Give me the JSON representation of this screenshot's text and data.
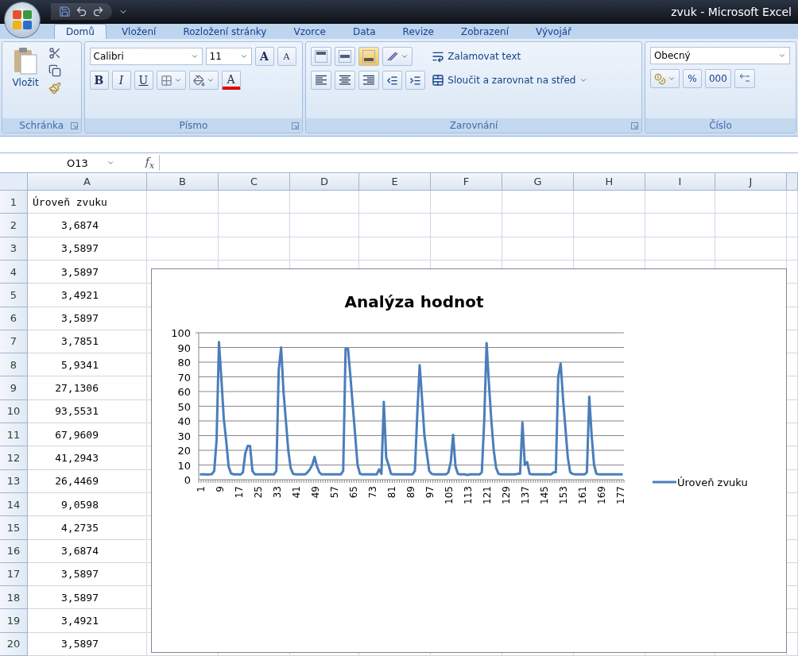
{
  "window": {
    "title": "zvuk - Microsoft Excel"
  },
  "tabs": [
    {
      "label": "Domů",
      "selected": true
    },
    {
      "label": "Vložení",
      "selected": false
    },
    {
      "label": "Rozložení stránky",
      "selected": false
    },
    {
      "label": "Vzorce",
      "selected": false
    },
    {
      "label": "Data",
      "selected": false
    },
    {
      "label": "Revize",
      "selected": false
    },
    {
      "label": "Zobrazení",
      "selected": false
    },
    {
      "label": "Vývojář",
      "selected": false
    }
  ],
  "ribbon": {
    "clipboard": {
      "paste": "Vložit",
      "label": "Schránka"
    },
    "font": {
      "font_name": "Calibri",
      "font_size": "11",
      "grow": "A",
      "shrink": "A",
      "bold": "B",
      "italic": "I",
      "underline": "U",
      "font_color": "A",
      "label": "Písmo"
    },
    "alignment": {
      "vertical": [
        {
          "kind": "top",
          "selected": false
        },
        {
          "kind": "middle",
          "selected": false
        },
        {
          "kind": "bottom",
          "selected": true
        }
      ],
      "wrap_text": "Zalamovat text",
      "merge": "Sloučit a zarovnat na střed",
      "label": "Zarovnání"
    },
    "number": {
      "format": "Obecný",
      "percent": "%",
      "thousands": "000",
      "label": "Číslo"
    }
  },
  "formula_bar": {
    "name_box": "O13",
    "function_label": "f$_{x}$"
  },
  "sheet": {
    "columns": [
      "A",
      "B",
      "C",
      "D",
      "E",
      "F",
      "G",
      "H",
      "I",
      "J"
    ],
    "rows": [
      {
        "number": "1",
        "a": "Úroveň zvuku"
      },
      {
        "number": "2",
        "a": "3,6874"
      },
      {
        "number": "3",
        "a": "3,5897"
      },
      {
        "number": "4",
        "a": "3,5897"
      },
      {
        "number": "5",
        "a": "3,4921"
      },
      {
        "number": "6",
        "a": "3,5897"
      },
      {
        "number": "7",
        "a": "3,7851"
      },
      {
        "number": "8",
        "a": "5,9341"
      },
      {
        "number": "9",
        "a": "27,1306"
      },
      {
        "number": "10",
        "a": "93,5531"
      },
      {
        "number": "11",
        "a": "67,9609"
      },
      {
        "number": "12",
        "a": "41,2943"
      },
      {
        "number": "13",
        "a": "26,4469"
      },
      {
        "number": "14",
        "a": "9,0598"
      },
      {
        "number": "15",
        "a": "4,2735"
      },
      {
        "number": "16",
        "a": "3,6874"
      },
      {
        "number": "17",
        "a": "3,5897"
      },
      {
        "number": "18",
        "a": "3,5897"
      },
      {
        "number": "19",
        "a": "3,4921"
      },
      {
        "number": "20",
        "a": "3,5897"
      }
    ],
    "chart": {
      "chart_data": {
        "type": "line",
        "title": "Analýza hodnot",
        "x": [
          1,
          2,
          3,
          4,
          5,
          6,
          7,
          8,
          9,
          10,
          11,
          12,
          13,
          14,
          15,
          16,
          17,
          18,
          19,
          20,
          21,
          22,
          23,
          24,
          25,
          26,
          27,
          28,
          29,
          30,
          31,
          32,
          33,
          34,
          35,
          36,
          37,
          38,
          39,
          40,
          41,
          42,
          43,
          44,
          45,
          46,
          47,
          48,
          49,
          50,
          51,
          52,
          53,
          54,
          55,
          56,
          57,
          58,
          59,
          60,
          61,
          62,
          63,
          64,
          65,
          66,
          67,
          68,
          69,
          70,
          71,
          72,
          73,
          74,
          75,
          76,
          77,
          78,
          79,
          80,
          81,
          82,
          83,
          84,
          85,
          86,
          87,
          88,
          89,
          90,
          91,
          92,
          93,
          94,
          95,
          96,
          97,
          98,
          99,
          100,
          101,
          102,
          103,
          104,
          105,
          106,
          107,
          108,
          109,
          110,
          111,
          112,
          113,
          114,
          115,
          116,
          117,
          118,
          119,
          120,
          121,
          122,
          123,
          124,
          125,
          126,
          127,
          128,
          129,
          130,
          131,
          132,
          133,
          134,
          135,
          136,
          137,
          138,
          139,
          140,
          141,
          142,
          143,
          144,
          145,
          146,
          147,
          148,
          149,
          150,
          151,
          152,
          153,
          154,
          155,
          156,
          157,
          158,
          159,
          160,
          161,
          162,
          163,
          164,
          165,
          166,
          167,
          168,
          169,
          170,
          171,
          172,
          173,
          174,
          175,
          176,
          177,
          178
        ],
        "xlim": [
          1,
          178
        ],
        "ylim": [
          0,
          100
        ],
        "grid": true,
        "xticks": [
          1,
          9,
          17,
          25,
          33,
          41,
          49,
          57,
          65,
          73,
          81,
          89,
          97,
          105,
          113,
          121,
          129,
          137,
          145,
          153,
          161,
          169,
          177
        ],
        "yticks": [
          0,
          10,
          20,
          30,
          40,
          50,
          60,
          70,
          80,
          90,
          100
        ],
        "series": [
          {
            "name": "Úroveň zvuku",
            "color": "#4a7ebb",
            "values": [
              3.7,
              3.6,
              3.6,
              3.5,
              3.6,
              3.8,
              5.9,
              27.1,
              93.6,
              68.0,
              41.3,
              26.4,
              9.1,
              4.3,
              3.7,
              3.6,
              3.6,
              3.5,
              5.0,
              18.0,
              23.0,
              23.0,
              6.0,
              3.7,
              3.6,
              3.6,
              3.6,
              3.6,
              3.6,
              3.6,
              3.6,
              3.6,
              6.0,
              75.0,
              90.0,
              60.0,
              40.0,
              20.0,
              8.0,
              4.0,
              3.6,
              3.6,
              3.6,
              3.6,
              3.6,
              5.0,
              7.0,
              10.0,
              15.5,
              9.0,
              5.0,
              3.6,
              3.6,
              3.6,
              3.6,
              3.6,
              3.6,
              3.6,
              3.6,
              3.6,
              6.0,
              89.0,
              89.0,
              70.0,
              50.0,
              30.0,
              10.0,
              4.0,
              3.6,
              3.6,
              3.6,
              3.6,
              3.6,
              3.6,
              3.6,
              7.0,
              4.0,
              53.0,
              15.0,
              10.0,
              4.0,
              3.6,
              3.6,
              3.6,
              3.6,
              3.6,
              3.6,
              3.6,
              3.6,
              3.6,
              6.0,
              45.0,
              78.0,
              55.0,
              30.0,
              18.0,
              6.0,
              4.0,
              3.6,
              3.6,
              3.6,
              3.6,
              3.6,
              3.6,
              5.0,
              12.0,
              30.5,
              9.0,
              4.0,
              3.6,
              3.6,
              3.6,
              3.2,
              3.6,
              3.6,
              3.6,
              3.6,
              3.6,
              5.0,
              40.0,
              93.0,
              65.0,
              40.0,
              20.0,
              8.0,
              4.0,
              3.6,
              3.6,
              3.6,
              3.6,
              3.6,
              3.6,
              3.6,
              4.0,
              4.0,
              39.0,
              10.0,
              12.0,
              4.0,
              3.6,
              3.6,
              3.6,
              3.6,
              3.6,
              3.6,
              3.6,
              3.6,
              3.6,
              5.0,
              5.0,
              70.0,
              79.0,
              55.0,
              35.0,
              15.0,
              5.0,
              4.0,
              3.6,
              3.6,
              3.6,
              3.6,
              3.6,
              5.0,
              56.5,
              30.0,
              10.0,
              4.0,
              3.6,
              3.6,
              3.6,
              3.6,
              3.6,
              3.6,
              3.6,
              3.6,
              3.6,
              3.6,
              3.6
            ]
          }
        ]
      }
    }
  }
}
